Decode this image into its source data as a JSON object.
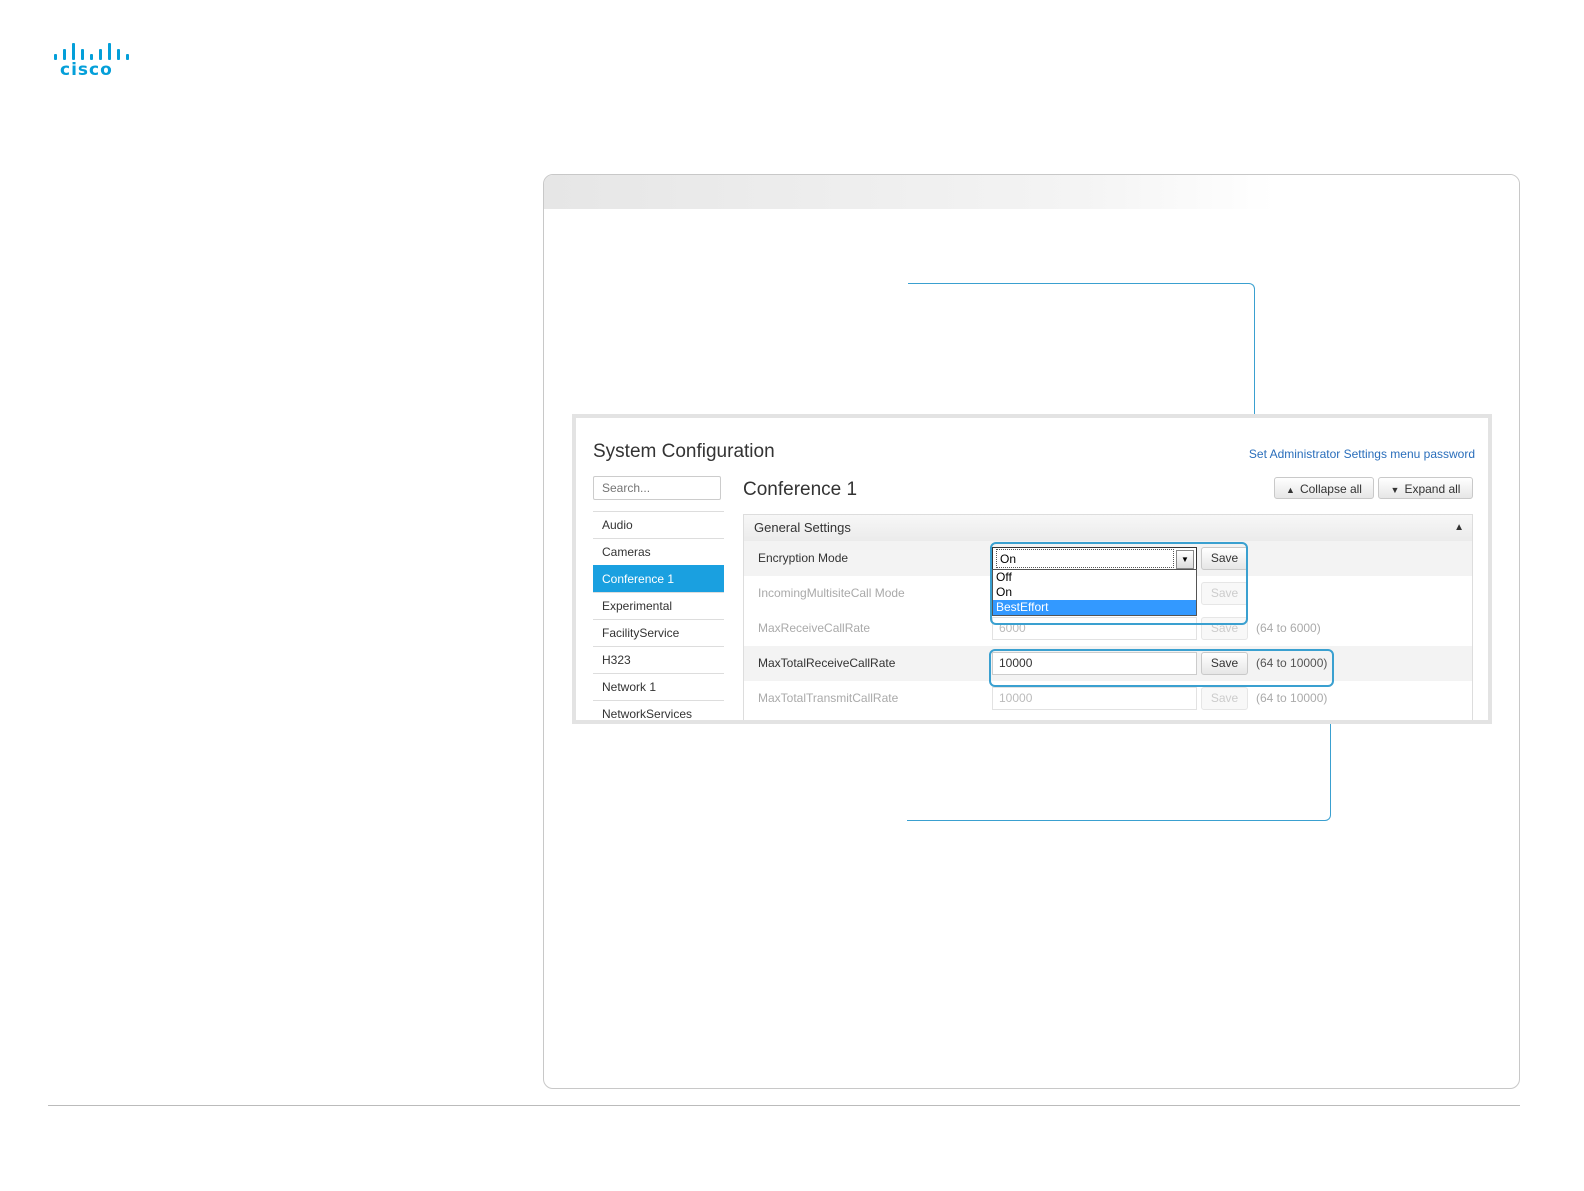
{
  "brand": {
    "logo_text": "cisco",
    "color": "#049fd9"
  },
  "page": {
    "title": "System Configuration",
    "admin_link": "Set Administrator Settings menu password",
    "search_placeholder": "Search...",
    "section_title": "Conference 1",
    "collapse_label": "Collapse all",
    "expand_label": "Expand all",
    "group_title": "General Settings"
  },
  "sidebar": {
    "items": [
      {
        "label": "Audio",
        "active": false
      },
      {
        "label": "Cameras",
        "active": false
      },
      {
        "label": "Conference 1",
        "active": true
      },
      {
        "label": "Experimental",
        "active": false
      },
      {
        "label": "FacilityService",
        "active": false
      },
      {
        "label": "H323",
        "active": false
      },
      {
        "label": "Network 1",
        "active": false
      },
      {
        "label": "NetworkServices",
        "active": false
      }
    ]
  },
  "settings": {
    "encryption": {
      "label": "Encryption Mode",
      "value": "On",
      "options": [
        "Off",
        "On",
        "BestEffort"
      ],
      "highlighted_option": "BestEffort",
      "save": "Save"
    },
    "incoming_multisite": {
      "label": "IncomingMultisiteCall Mode",
      "save": "Save"
    },
    "max_receive": {
      "label": "MaxReceiveCallRate",
      "value": "6000",
      "save": "Save",
      "range": "(64 to 6000)"
    },
    "max_total_receive": {
      "label": "MaxTotalReceiveCallRate",
      "value": "10000",
      "save": "Save",
      "range": "(64 to 10000)"
    },
    "max_total_transmit": {
      "label": "MaxTotalTransmitCallRate",
      "value": "10000",
      "save": "Save",
      "range": "(64 to 10000)"
    }
  },
  "colors": {
    "accent": "#1aa0e0",
    "callout": "#3aa0d0",
    "link": "#2a6ebb"
  }
}
